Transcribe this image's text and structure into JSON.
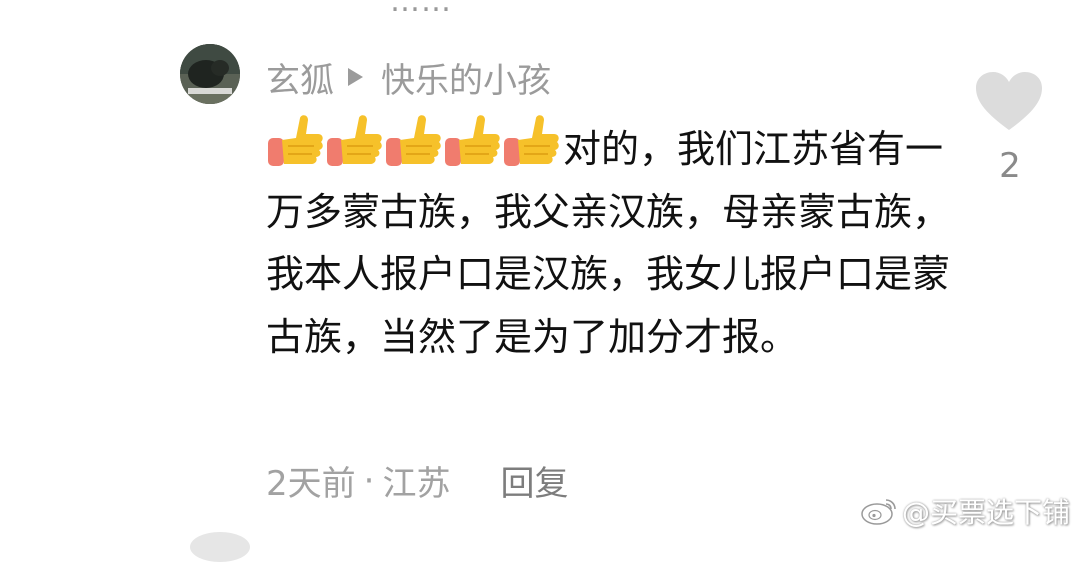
{
  "top_partial_text": "……",
  "comment": {
    "author": "玄狐",
    "reply_to": "快乐的小孩",
    "text": "对的，我们江苏省有一万多蒙古族，我父亲汉族，母亲蒙古族，我本人报户口是汉族，我女儿报户口是蒙古族，当然了是为了加分才报。",
    "emoji_count": 5,
    "emoji_icon": "thumbs-up-icon",
    "like_count": "2",
    "time": "2天前",
    "separator": "·",
    "location": "江苏",
    "reply_label": "回复"
  },
  "watermark": {
    "text": "@买票选下铺",
    "icon": "weibo-logo"
  },
  "colors": {
    "author": "#9b9b9b",
    "body": "#111111",
    "meta": "#a2a2a2",
    "heart": "#dcdcdc",
    "thumb_yellow": "#f6c12a",
    "thumb_cuff": "#f07c6e"
  }
}
